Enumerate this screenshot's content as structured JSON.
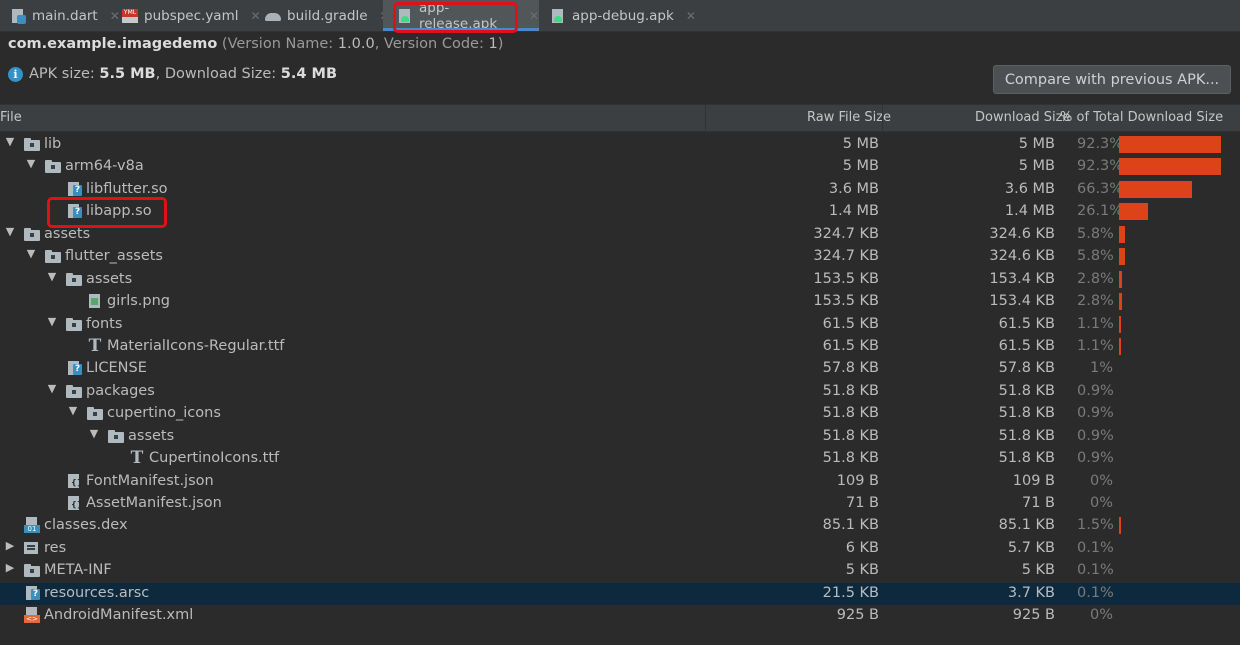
{
  "tabs": [
    {
      "label": "main.dart",
      "icon": "dart-file-icon"
    },
    {
      "label": "pubspec.yaml",
      "icon": "yaml-file-icon"
    },
    {
      "label": "build.gradle",
      "icon": "gradle-icon"
    },
    {
      "label": "app-release.apk",
      "icon": "apk-file-icon"
    },
    {
      "label": "app-debug.apk",
      "icon": "apk-file-icon"
    }
  ],
  "active_tab": "app-release.apk",
  "apk": {
    "package": "com.example.imagedemo",
    "version_prefix": "(Version Name: ",
    "version_name": "1.0.0",
    "version_mid": ", Version Code: ",
    "version_code": "1",
    "version_suffix": ")",
    "size_label": "APK size: ",
    "size": "5.5 MB",
    "download_label": ", Download Size: ",
    "download_size": "5.4 MB"
  },
  "compare_button": "Compare with previous APK...",
  "columns": {
    "file": "File",
    "raw": "Raw File Size",
    "download": "Download Size",
    "percent": "% of Total Download Size"
  },
  "rows": [
    {
      "name": "lib",
      "depth": 0,
      "arrow": "down",
      "icon": "folder",
      "raw": "5 MB",
      "download": "5 MB",
      "percent": "92.3%",
      "share": 92.3
    },
    {
      "name": "arm64-v8a",
      "depth": 1,
      "arrow": "down",
      "icon": "folder",
      "raw": "5 MB",
      "download": "5 MB",
      "percent": "92.3%",
      "share": 92.3
    },
    {
      "name": "libflutter.so",
      "depth": 2,
      "arrow": "none",
      "icon": "unknown",
      "raw": "3.6 MB",
      "download": "3.6 MB",
      "percent": "66.3%",
      "share": 66.3
    },
    {
      "name": "libapp.so",
      "depth": 2,
      "arrow": "none",
      "icon": "unknown",
      "raw": "1.4 MB",
      "download": "1.4 MB",
      "percent": "26.1%",
      "share": 26.1
    },
    {
      "name": "assets",
      "depth": 0,
      "arrow": "down",
      "icon": "folder",
      "raw": "324.7 KB",
      "download": "324.6 KB",
      "percent": "5.8%",
      "share": 5.8
    },
    {
      "name": "flutter_assets",
      "depth": 1,
      "arrow": "down",
      "icon": "folder",
      "raw": "324.7 KB",
      "download": "324.6 KB",
      "percent": "5.8%",
      "share": 5.8
    },
    {
      "name": "assets",
      "depth": 2,
      "arrow": "down",
      "icon": "folder",
      "raw": "153.5 KB",
      "download": "153.4 KB",
      "percent": "2.8%",
      "share": 2.8
    },
    {
      "name": "girls.png",
      "depth": 3,
      "arrow": "none",
      "icon": "image",
      "raw": "153.5 KB",
      "download": "153.4 KB",
      "percent": "2.8%",
      "share": 2.8
    },
    {
      "name": "fonts",
      "depth": 2,
      "arrow": "down",
      "icon": "folder",
      "raw": "61.5 KB",
      "download": "61.5 KB",
      "percent": "1.1%",
      "share": 1.1
    },
    {
      "name": "MaterialIcons-Regular.ttf",
      "depth": 3,
      "arrow": "none",
      "icon": "font",
      "raw": "61.5 KB",
      "download": "61.5 KB",
      "percent": "1.1%",
      "share": 1.1
    },
    {
      "name": "LICENSE",
      "depth": 2,
      "arrow": "none",
      "icon": "unknown",
      "raw": "57.8 KB",
      "download": "57.8 KB",
      "percent": "1%",
      "share": 0
    },
    {
      "name": "packages",
      "depth": 2,
      "arrow": "down",
      "icon": "folder",
      "raw": "51.8 KB",
      "download": "51.8 KB",
      "percent": "0.9%",
      "share": 0
    },
    {
      "name": "cupertino_icons",
      "depth": 3,
      "arrow": "down",
      "icon": "folder",
      "raw": "51.8 KB",
      "download": "51.8 KB",
      "percent": "0.9%",
      "share": 0
    },
    {
      "name": "assets",
      "depth": 4,
      "arrow": "down",
      "icon": "folder",
      "raw": "51.8 KB",
      "download": "51.8 KB",
      "percent": "0.9%",
      "share": 0
    },
    {
      "name": "CupertinoIcons.ttf",
      "depth": 5,
      "arrow": "none",
      "icon": "font",
      "raw": "51.8 KB",
      "download": "51.8 KB",
      "percent": "0.9%",
      "share": 0
    },
    {
      "name": "FontManifest.json",
      "depth": 2,
      "arrow": "none",
      "icon": "json",
      "raw": "109 B",
      "download": "109 B",
      "percent": "0%",
      "share": 0
    },
    {
      "name": "AssetManifest.json",
      "depth": 2,
      "arrow": "none",
      "icon": "json",
      "raw": "71 B",
      "download": "71 B",
      "percent": "0%",
      "share": 0
    },
    {
      "name": "classes.dex",
      "depth": 0,
      "arrow": "none",
      "icon": "dex",
      "raw": "85.1 KB",
      "download": "85.1 KB",
      "percent": "1.5%",
      "share": 1.5
    },
    {
      "name": "res",
      "depth": 0,
      "arrow": "right",
      "icon": "res",
      "raw": "6 KB",
      "download": "5.7 KB",
      "percent": "0.1%",
      "share": 0
    },
    {
      "name": "META-INF",
      "depth": 0,
      "arrow": "right",
      "icon": "folder",
      "raw": "5 KB",
      "download": "5 KB",
      "percent": "0.1%",
      "share": 0
    },
    {
      "name": "resources.arsc",
      "depth": 0,
      "arrow": "none",
      "icon": "unknown",
      "raw": "21.5 KB",
      "download": "3.7 KB",
      "percent": "0.1%",
      "share": 0,
      "selected": true
    },
    {
      "name": "AndroidManifest.xml",
      "depth": 0,
      "arrow": "none",
      "icon": "xml",
      "raw": "925 B",
      "download": "925 B",
      "percent": "0%",
      "share": 0
    }
  ],
  "highlights": [
    "app-release.apk",
    "libapp.so"
  ],
  "colors": {
    "bar": "#dc4318",
    "highlight": "#e0101b",
    "selected_row": "#0d293e"
  }
}
